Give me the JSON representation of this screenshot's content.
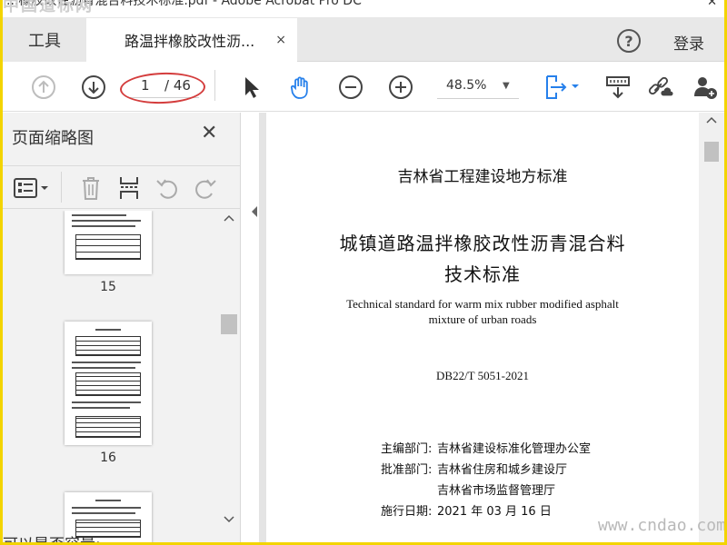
{
  "window": {
    "title": "...橡胶改性沥青混合料技术标准.pdf - Adobe Acrobat Pro DC",
    "close_glyph": "✕",
    "watermark_top": "中国道标网"
  },
  "tabs": {
    "tools_label": "工具",
    "doc_label": "路温拌橡胶改性沥...",
    "doc_close": "×",
    "help_glyph": "?",
    "login_label": "登录"
  },
  "toolbar": {
    "current_page": "1",
    "total_pages": "/ 46",
    "zoom": "48.5%",
    "zoom_caret": "▼",
    "annotation_color": "#d43d3d",
    "accent_color": "#2680eb"
  },
  "sidebar": {
    "title": "页面缩略图",
    "close_glyph": "✕",
    "thumbnails": [
      {
        "label": "15"
      },
      {
        "label": "16"
      }
    ]
  },
  "document": {
    "org": "吉林省工程建设地方标准",
    "title_line1": "城镇道路温拌橡胶改性沥青混合料",
    "title_line2": "技术标准",
    "en_line1": "Technical standard for warm mix rubber modified asphalt",
    "en_line2": "mixture of urban roads",
    "code": "DB22/T 5051-2021",
    "editor_label": "主编部门:",
    "editor_value": "吉林省建设标准化管理办公室",
    "approver_label": "批准部门:",
    "approver_value1": "吉林省住房和城乡建设厅",
    "approver_value2": "吉林省市场监督管理厅",
    "date_label": "施行日期:",
    "date_value": "2021 年 03 月 16 日"
  },
  "watermark_bottom": "www.cndao.com",
  "bottom_text": "可以是否容量:"
}
